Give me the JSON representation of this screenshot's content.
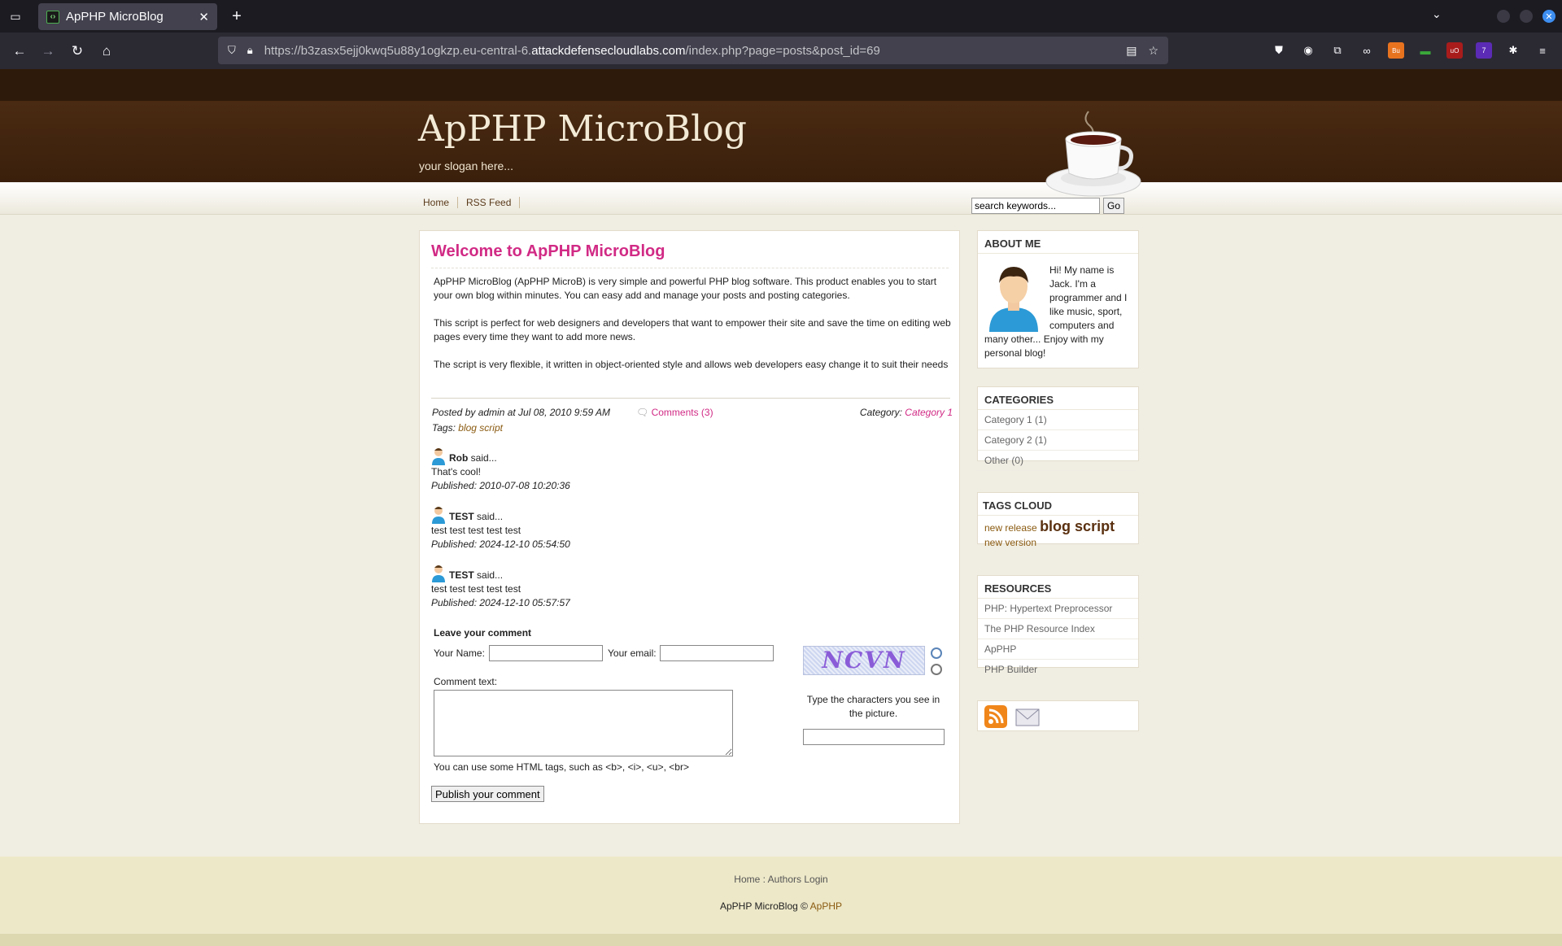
{
  "browser": {
    "tab_title": "ApPHP MicroBlog",
    "url_prefix": "https://b3zasx5ejj0kwq5u88y1ogkzp.eu-central-6.",
    "url_domain": "attackdefensecloudlabs.com",
    "url_path": "/index.php?page=posts&post_id=69"
  },
  "site": {
    "title": "ApPHP MicroBlog",
    "slogan": "your slogan here...",
    "nav": [
      "Home",
      "RSS Feed"
    ],
    "search_placeholder": "search keywords...",
    "search_button": "Go"
  },
  "post": {
    "title": "Welcome to ApPHP MicroBlog",
    "paragraphs": [
      "ApPHP MicroBlog (ApPHP MicroB) is very simple and powerful PHP blog software. This product enables you to start your own blog within minutes. You can easy add and manage your posts and posting categories.",
      "This script is perfect for web designers and developers that want to empower their site and save the time on editing web pages every time they want to add more news.",
      "The script is very flexible, it written in object-oriented style and allows web developers easy change it to suit their needs"
    ],
    "posted_by": "Posted by admin at Jul 08, 2010 9:59 AM",
    "comments_link": "Comments (3)",
    "category_label": "Category:",
    "category": "Category 1",
    "tags_label": "Tags:",
    "tags": "blog script"
  },
  "comments": [
    {
      "author": "Rob",
      "said": "said...",
      "text": "That's cool!",
      "published": "Published: 2010-07-08 10:20:36"
    },
    {
      "author": "TEST",
      "said": "said...",
      "text": "test test test test test",
      "published": "Published: 2024-12-10 05:54:50"
    },
    {
      "author": "TEST",
      "said": "said...",
      "text": "test test test test test",
      "published": "Published: 2024-12-10 05:57:57"
    }
  ],
  "form": {
    "heading": "Leave your comment",
    "name_label": "Your Name:",
    "email_label": "Your email:",
    "comment_label": "Comment text:",
    "html_hint": "You can use some HTML tags, such as <b>, <i>, <u>, <br>",
    "captcha_text": "NCVN",
    "captcha_hint": "Type the characters you see in the picture.",
    "publish_button": "Publish your comment"
  },
  "sidebar": {
    "about_title": "ABOUT ME",
    "about_text": "Hi! My name is Jack. I'm a programmer and I like music, sport, computers and many other... Enjoy with my personal blog!",
    "categories_title": "CATEGORIES",
    "categories": [
      "Category 1 (1)",
      "Category 2 (1)",
      "Other (0)"
    ],
    "tags_title": "TAGS CLOUD",
    "tag_new_release": "new release",
    "tag_blog_script": "blog script",
    "tag_new_version": "new version",
    "resources_title": "RESOURCES",
    "resources": [
      "PHP: Hypertext Preprocessor",
      "The PHP Resource Index",
      "ApPHP",
      "PHP Builder"
    ]
  },
  "footer": {
    "home": "Home",
    "sep": ":",
    "authors_login": "Authors Login",
    "copy_prefix": "ApPHP MicroBlog ©",
    "copy_link": "ApPHP"
  },
  "colors": {
    "accent": "#d12a85",
    "header_brown": "#4a2a12",
    "tag_brown": "#8a5a10"
  }
}
